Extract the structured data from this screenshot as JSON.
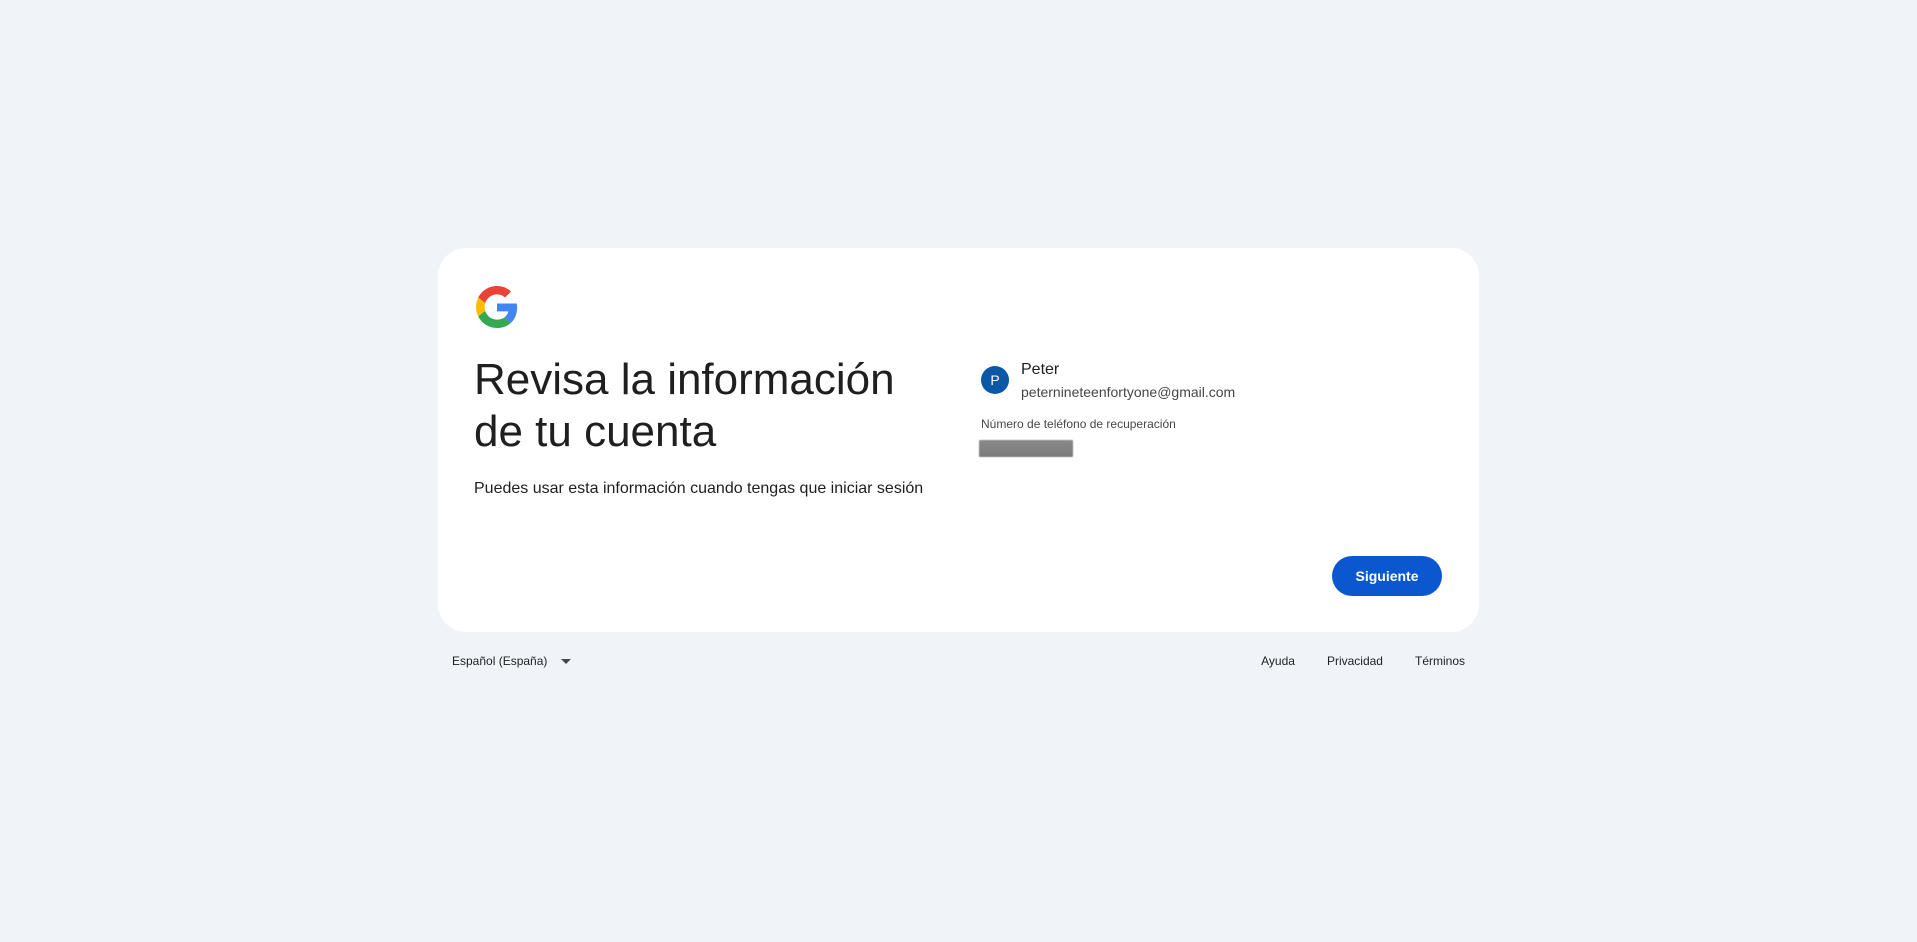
{
  "brand": {
    "logo_icon": "google-g-logo-icon",
    "colors": {
      "blue": "#4285F4",
      "red": "#EA4335",
      "yellow": "#FBBC05",
      "green": "#34A853"
    }
  },
  "page": {
    "title": "Revisa la información de tu cuenta",
    "subtitle": "Puedes usar esta información cuando tengas que iniciar sesión"
  },
  "account": {
    "avatar_initial": "P",
    "avatar_color": "#0b57a8",
    "name": "Peter",
    "email": "peternineteenfortyone@gmail.com"
  },
  "recovery": {
    "label": "Número de teléfono de recuperación",
    "value_redacted": true
  },
  "actions": {
    "next_label": "Siguiente",
    "next_color": "#0b57d0"
  },
  "footer": {
    "language": "Español (España)",
    "links": [
      {
        "label": "Ayuda"
      },
      {
        "label": "Privacidad"
      },
      {
        "label": "Términos"
      }
    ]
  }
}
